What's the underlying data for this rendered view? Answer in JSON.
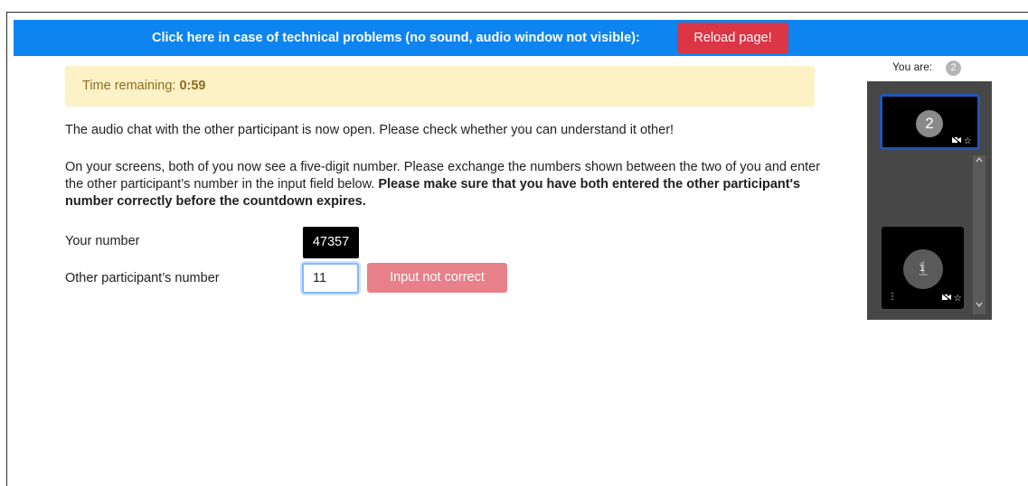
{
  "banner": {
    "text": "Click here in case of technical problems (no sound, audio window not visible):",
    "reload_label": "Reload page!"
  },
  "timer": {
    "label": "Time remaining:",
    "value": "0:59"
  },
  "instructions": {
    "p1": "The audio chat with the other participant is now open. Please check whether you can understand it other!",
    "p2_normal": "On your screens, both of you now see a five-digit number. Please exchange the numbers shown between the two of you and enter the other participant’s number in the input field below. ",
    "p2_bold": "Please make sure that you have both entered the other participant's number correctly before the countdown expires."
  },
  "form": {
    "your_number_label": "Your number",
    "your_number_value": "47357",
    "other_number_label": "Other participant’s number",
    "other_number_value": "11",
    "submit_label": "Input not correct"
  },
  "video_panel": {
    "you_are_label": "You are:",
    "you_are_id": "2",
    "self_tile_number": "2",
    "other_tile_number": "1",
    "other_tile_small_number": "1"
  }
}
